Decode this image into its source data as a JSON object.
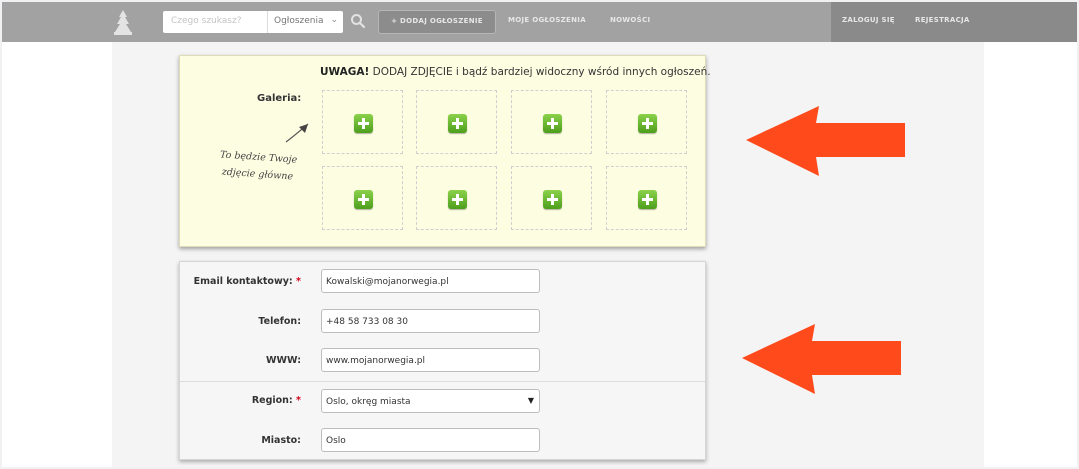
{
  "nav": {
    "search_placeholder": "Czego szukasz?",
    "category_value": "Ogłoszenia",
    "add_listing": "+ DODAJ OGŁOSZENIE",
    "my_listings": "MOJE OGŁOSZENIA",
    "news": "NOWOŚCI",
    "login": "ZALOGUJ SIĘ",
    "register": "REJESTRACJA"
  },
  "gallery": {
    "notice_strong": "UWAGA!",
    "notice_text": " DODAJ ZDJĘCIE i bądź bardziej widoczny wśród innych ogłoszeń.",
    "label": "Galeria:",
    "hint_line1": "To będzie Twoje",
    "hint_line2": "zdjęcie główne"
  },
  "form": {
    "email_label": "Email kontaktowy:",
    "email_value": "Kowalski@mojanorwegia.pl",
    "phone_label": "Telefon:",
    "phone_value": "+48 58 733 08 30",
    "www_label": "WWW:",
    "www_value": "www.mojanorwegia.pl",
    "region_label": "Region:",
    "region_value": "Oslo, okręg miasta",
    "city_label": "Miasto:",
    "city_value": "Oslo",
    "required_mark": "*"
  },
  "colors": {
    "arrow": "#ff4a1c",
    "plus_green": "#5fb12a",
    "gallery_bg": "#fdfde2",
    "nav_bg": "#a2a2a2"
  }
}
